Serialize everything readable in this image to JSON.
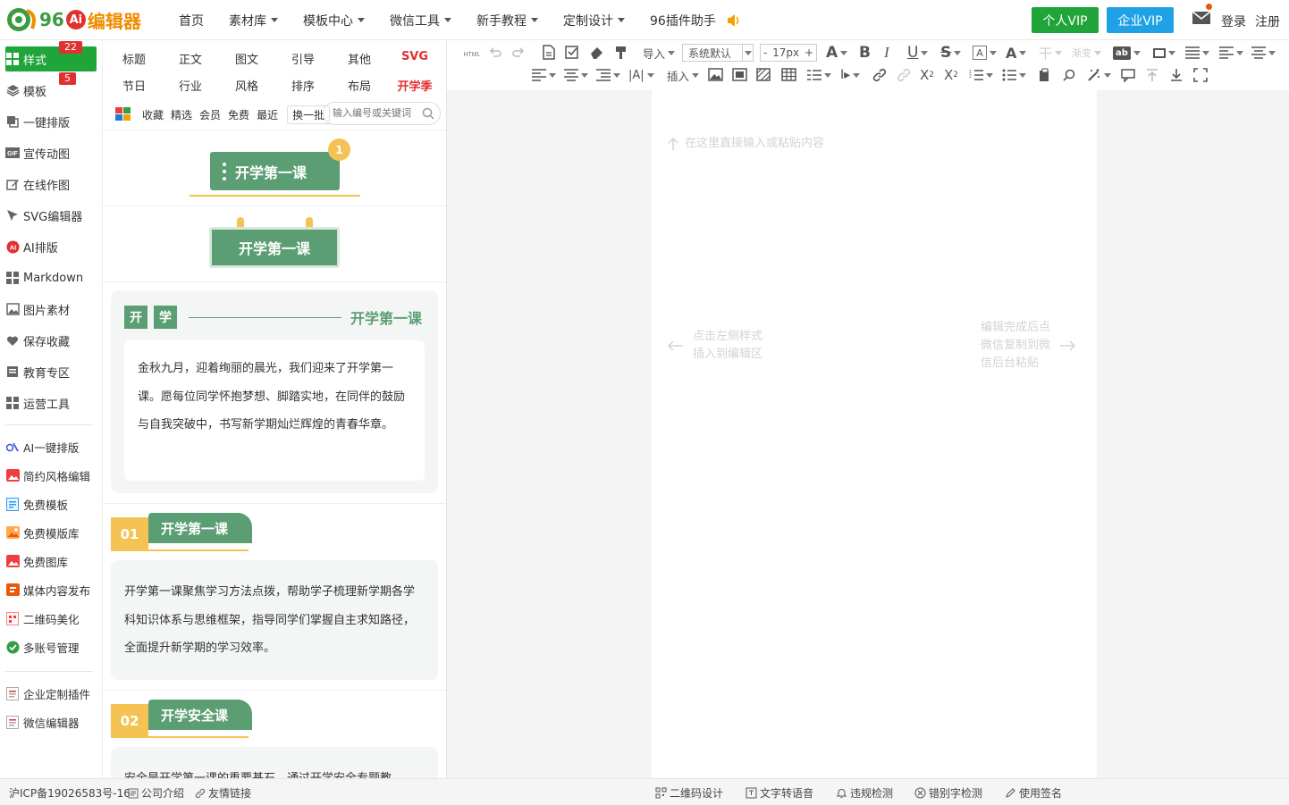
{
  "brand": {
    "number": "96",
    "ai": "Ai",
    "name": "编辑器"
  },
  "nav": {
    "items": [
      {
        "label": "首页",
        "dropdown": false
      },
      {
        "label": "素材库",
        "dropdown": true
      },
      {
        "label": "模板中心",
        "dropdown": true
      },
      {
        "label": "微信工具",
        "dropdown": true
      },
      {
        "label": "新手教程",
        "dropdown": true
      },
      {
        "label": "定制设计",
        "dropdown": true
      },
      {
        "label": "96插件助手",
        "dropdown": false
      }
    ]
  },
  "header": {
    "vip_personal": "个人VIP",
    "vip_enterprise": "企业VIP",
    "login": "登录",
    "register": "注册"
  },
  "colors": {
    "green": "#20a53a",
    "blue": "#1fa2e5",
    "template_green": "#5c9e73",
    "accent_yellow": "#f5c354",
    "red_badge": "#e03131"
  },
  "sidebar": {
    "items": [
      {
        "label": "样式",
        "icon": "grid-icon",
        "badge": "22"
      },
      {
        "label": "模板",
        "icon": "layers-icon",
        "badge": "5"
      },
      {
        "label": "一键排版",
        "icon": "copy-icon"
      },
      {
        "label": "宣传动图",
        "icon": "gif-icon"
      },
      {
        "label": "在线作图",
        "icon": "edit-image-icon"
      },
      {
        "label": "SVG编辑器",
        "icon": "cursor-icon"
      },
      {
        "label": "AI排版",
        "icon": "ai-icon"
      },
      {
        "label": "Markdown",
        "icon": "grid-icon"
      },
      {
        "label": "图片素材",
        "icon": "image-icon"
      },
      {
        "label": "保存收藏",
        "icon": "heart-icon"
      },
      {
        "label": "教育专区",
        "icon": "book-icon"
      },
      {
        "label": "运营工具",
        "icon": "grid-icon"
      }
    ],
    "tools": [
      {
        "label": "AI一键排版",
        "icon": "ai-layout-icon"
      },
      {
        "label": "简约风格编辑",
        "icon": "picture-icon"
      },
      {
        "label": "免费模板",
        "icon": "template-icon"
      },
      {
        "label": "免费模版库",
        "icon": "gallery-icon"
      },
      {
        "label": "免费图库",
        "icon": "photo-icon"
      },
      {
        "label": "媒体内容发布",
        "icon": "publish-icon"
      },
      {
        "label": "二维码美化",
        "icon": "qrcode-icon"
      },
      {
        "label": "多账号管理",
        "icon": "check-badge-icon"
      }
    ],
    "plugins": [
      {
        "label": "企业定制插件",
        "icon": "plugin-icon"
      },
      {
        "label": "微信编辑器",
        "icon": "plugin-icon"
      }
    ]
  },
  "categories": {
    "row1": [
      "标题",
      "正文",
      "图文",
      "引导",
      "其他",
      "SVG"
    ],
    "row2": [
      "节日",
      "行业",
      "风格",
      "排序",
      "布局",
      "开学季"
    ]
  },
  "filters": {
    "items": [
      "收藏",
      "精选",
      "会员",
      "免费",
      "最近"
    ],
    "shuffle": "换一批",
    "search_placeholder": "输入编号或关键词"
  },
  "templates": {
    "t1": {
      "title": "开学第一课",
      "badge": "1"
    },
    "t2": {
      "title": "开学第一课"
    },
    "t3": {
      "tag1": "开",
      "tag2": "学",
      "title": "开学第一课",
      "body": "金秋九月，迎着绚丽的晨光，我们迎来了开学第一课。愿每位同学怀抱梦想、脚踏实地，在同伴的鼓励与自我突破中，书写新学期灿烂辉煌的青春华章。"
    },
    "t4": {
      "num": "01",
      "title": "开学第一课",
      "body": "开学第一课聚焦学习方法点拨，帮助学子梳理新学期各学科知识体系与思维框架，指导同学们掌握自主求知路径，全面提升新学期的学习效率。"
    },
    "t5": {
      "num": "02",
      "title": "开学安全课",
      "body": "安全是开学第一课的重要基石，通过开学安全专题教"
    }
  },
  "toolbar": {
    "import": "导入",
    "font": "系统默认",
    "size": "17px",
    "insert": "插入",
    "gradient": "渐变"
  },
  "editor": {
    "placeholder": "在这里直接输入或粘贴内容",
    "left_hint_1": "点击左侧样式",
    "left_hint_2": "插入到编辑区",
    "right_hint_1": "编辑完成后点",
    "right_hint_2": "微信复制到微",
    "right_hint_3": "信后台粘贴"
  },
  "footer": {
    "icp": "沪ICP备19026583号-16",
    "about": "公司介绍",
    "links": "友情链接",
    "tools": [
      "二维码设计",
      "文字转语音",
      "违规检测",
      "错别字检测",
      "使用签名"
    ]
  }
}
